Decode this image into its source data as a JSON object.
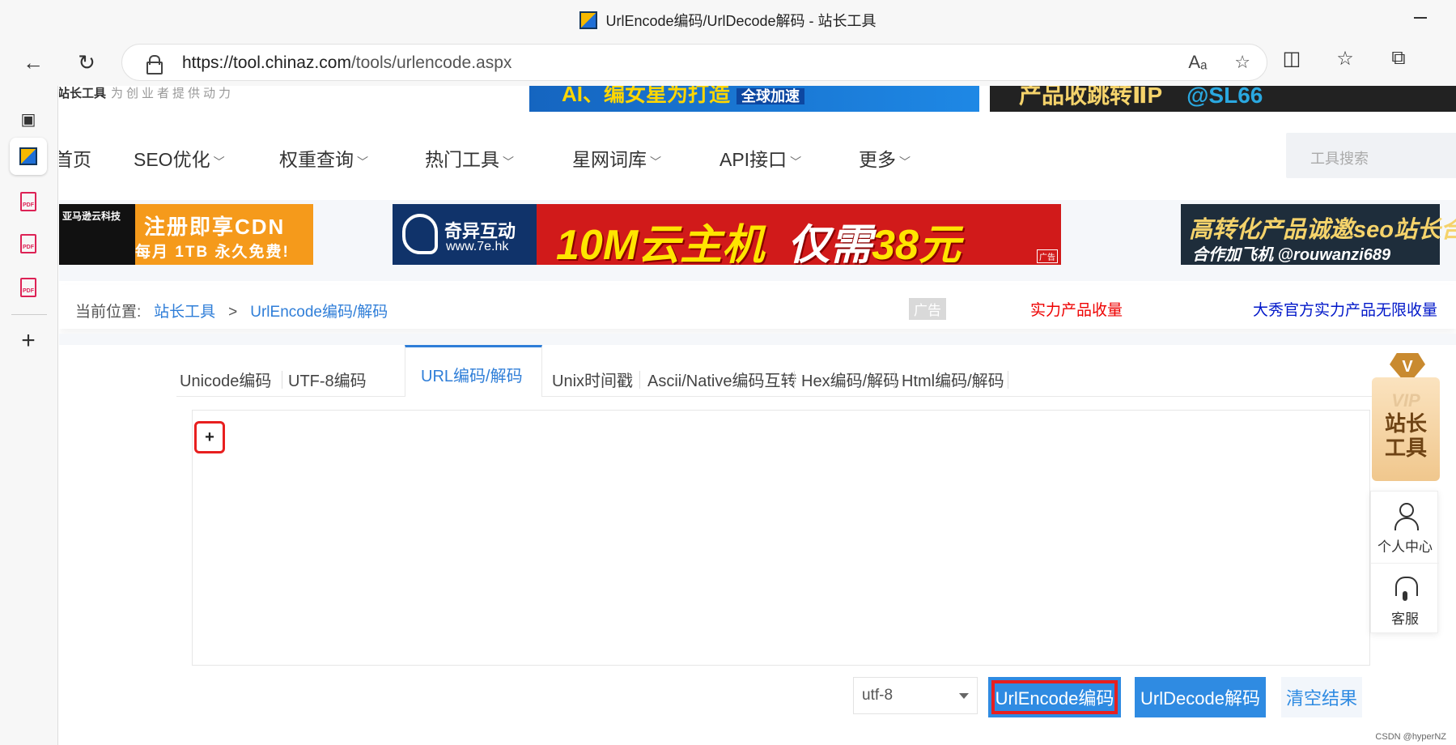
{
  "window": {
    "title": "UrlEncode编码/UrlDecode解码 - 站长工具"
  },
  "browser": {
    "url_host": "https://tool.chinaz.com",
    "url_path": "/tools/urlencode.aspx",
    "read_aloud_icon": "Aₐ"
  },
  "site": {
    "brand": "站长工具",
    "slogan": "为创业者提供动力",
    "top_ad1": "AI、编女星为打造",
    "top_ad1_sub": "全球加速",
    "top_ad2": "产品收跳转ⅡP",
    "top_ad2_tg": "@SL66"
  },
  "mainnav": {
    "items": [
      "首页",
      "SEO优化",
      "权重查询",
      "热门工具",
      "星网词库",
      "API接口",
      "更多"
    ],
    "search_placeholder": "工具搜索"
  },
  "banners": {
    "amazon_brand": "亚马逊云科技",
    "amazon_t1": "注册即享CDN",
    "amazon_t2": "每月 1TB 永久免费!",
    "qiyi_name": "奇异互动",
    "qiyi_www": "www.7e.hk",
    "qiyi_headline_a": "10M云主机",
    "qiyi_headline_b": "仅需",
    "qiyi_headline_c": "38元",
    "ad_tag": "广告",
    "feiji_t1": "高转化产品诚邀seo站长合作",
    "feiji_t2": "合作加飞机 @rouwanzi689"
  },
  "breadcrumb": {
    "prefix": "当前位置:",
    "home": "站长工具",
    "separator": ">",
    "current": "UrlEncode编码/解码",
    "ad_label": "广告",
    "ad_text1": "实力产品收量",
    "ad_text2": "大秀官方实力产品无限收量"
  },
  "tabs": [
    {
      "label": "Unicode编码"
    },
    {
      "label": "UTF-8编码"
    },
    {
      "label": "URL编码/解码"
    },
    {
      "label": "Unix时间戳"
    },
    {
      "label": "Ascii/Native编码互转"
    },
    {
      "label": "Hex编码/解码"
    },
    {
      "label": "Html编码/解码"
    }
  ],
  "editor": {
    "content": "+"
  },
  "actions": {
    "charset": "utf-8",
    "encode": "UrlEncode编码",
    "decode": "UrlDecode解码",
    "clear": "清空结果"
  },
  "float_panel": {
    "vip_v": "V",
    "vip_title_a": "VIP",
    "vip_title_b": "站长",
    "vip_title_c": "工具",
    "user_center": "个人中心",
    "customer_service": "客服"
  },
  "watermark": "CSDN @hyperNZ"
}
